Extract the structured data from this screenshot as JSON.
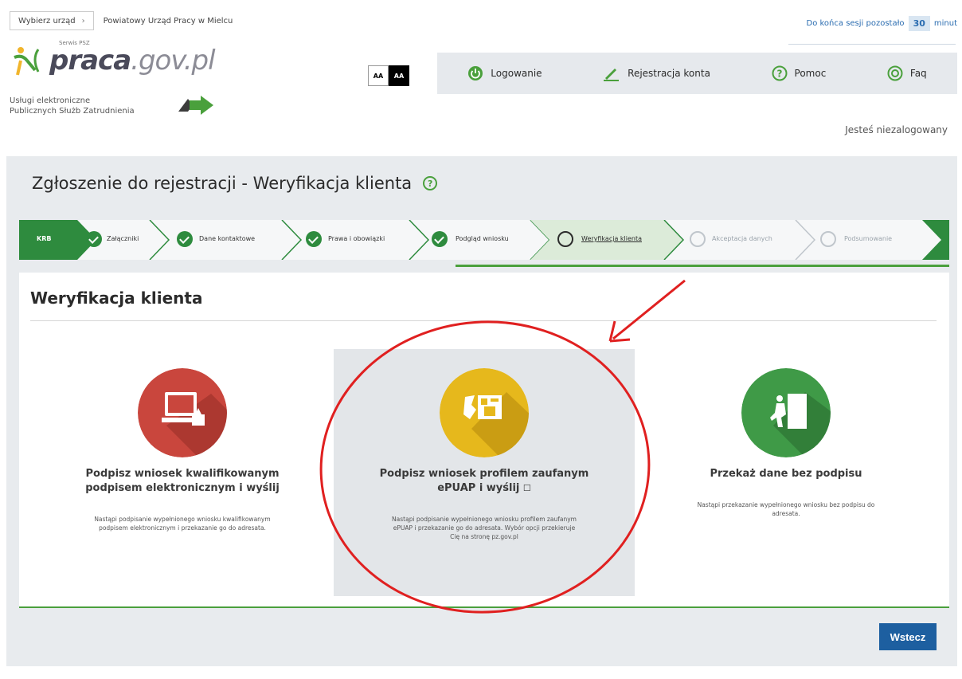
{
  "header": {
    "office_select_label": "Wybierz urząd",
    "office_name": "Powiatowy Urząd Pracy w Mielcu",
    "session_prefix": "Do końca sesji pozostało",
    "session_minutes": "30",
    "session_suffix": "minut",
    "logo": {
      "small": "Serwis PSZ",
      "praca": "praca",
      "gov": ".gov.pl"
    },
    "services_line1": "Usługi elektroniczne",
    "services_line2": "Publicznych Służb Zatrudnienia",
    "contrast_normal": "AA",
    "contrast_high": "AA",
    "nav": [
      {
        "label": "Logowanie",
        "icon": "power-icon"
      },
      {
        "label": "Rejestracja konta",
        "icon": "pencil-icon"
      },
      {
        "label": "Pomoc",
        "icon": "help-icon"
      },
      {
        "label": "Faq",
        "icon": "faq-icon"
      }
    ],
    "login_status": "Jesteś niezalogowany"
  },
  "page": {
    "title": "Zgłoszenie do rejestracji - Weryfikacja klienta",
    "help_symbol": "?",
    "section_title": "Weryfikacja klienta",
    "back_label": "Wstecz"
  },
  "steps": [
    {
      "label": "KRB",
      "state": "start"
    },
    {
      "label": "Załączniki",
      "state": "done"
    },
    {
      "label": "Dane kontaktowe",
      "state": "done"
    },
    {
      "label": "Prawa i obowiązki",
      "state": "done"
    },
    {
      "label": "Podgląd wniosku",
      "state": "done"
    },
    {
      "label": "Weryfikacja klienta",
      "state": "current"
    },
    {
      "label": "Akceptacja danych",
      "state": "todo"
    },
    {
      "label": "Podsumowanie",
      "state": "todo"
    }
  ],
  "options": [
    {
      "title": "Podpisz wniosek kwalifikowanym podpisem elektronicznym i wyślij",
      "desc": "Nastąpi podpisanie wypełnionego wniosku kwalifikowanym podpisem elektronicznym i przekazanie go do adresata.",
      "color": "#c9463d",
      "icon": "computer-signature-icon"
    },
    {
      "title": "Podpisz wniosek profilem zaufanym ePUAP i wyślij",
      "ext_icon": "☐",
      "desc": "Nastąpi podpisanie wypełnionego wniosku profilem zaufanym ePUAP i przekazanie go do adresata. Wybór opcji przekieruje Cię na stronę pz.gov.pl",
      "color": "#e6b81c",
      "icon": "trusted-profile-icon"
    },
    {
      "title": "Przekaż dane bez podpisu",
      "desc": "Nastąpi przekazanie wypełnionego wniosku bez podpisu do adresata.",
      "color": "#3f9a47",
      "icon": "person-door-icon"
    }
  ],
  "colors": {
    "accent_green": "#4aa03c",
    "step_green": "#2e8b3e",
    "button_blue": "#1d5fa0",
    "annotation_red": "#e02020"
  }
}
